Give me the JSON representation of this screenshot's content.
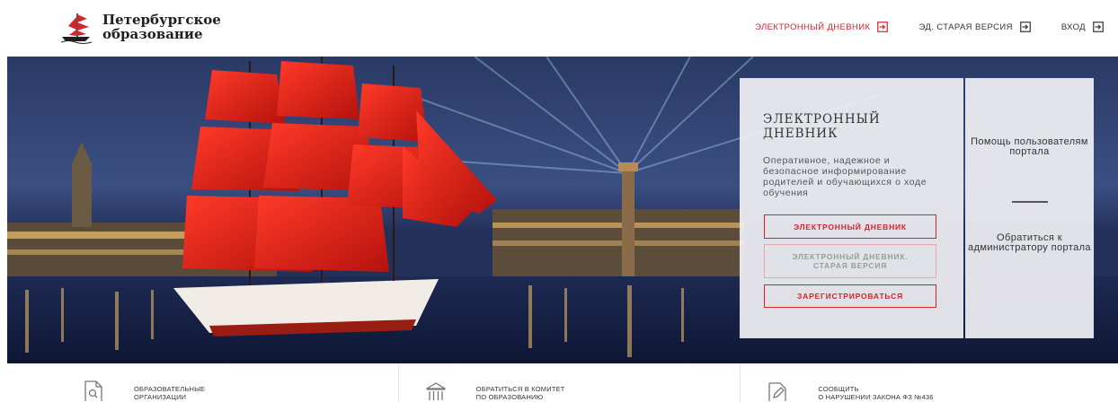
{
  "brand": {
    "line1": "Петербургское",
    "line2": "образование",
    "logo_icon": "scarlet-sails-ship-icon"
  },
  "nav": [
    {
      "label": "ЭЛЕКТРОННЫЙ ДНЕВНИК",
      "icon": "login-icon",
      "active": true
    },
    {
      "label": "ЭД. СТАРАЯ ВЕРСИЯ",
      "icon": "login-icon",
      "active": false
    },
    {
      "label": "ВХОД",
      "icon": "login-icon",
      "active": false
    }
  ],
  "hero": {
    "panel": {
      "title": "ЭЛЕКТРОННЫЙ ДНЕВНИК",
      "description": "Оперативное, надежное и безопасное информирование родителей и обучающихся о ходе обучения",
      "buttons": {
        "diary": "ЭЛЕКТРОННЫЙ ДНЕВНИК",
        "old_version": "ЭЛЕКТРОННЫЙ ДНЕВНИК. СТАРАЯ ВЕРСИЯ",
        "register": "ЗАРЕГИСТРИРОВАТЬСЯ"
      }
    },
    "help": {
      "users_help": "Помощь пользователям портала",
      "contact_admin": "Обратиться к администратору портала"
    }
  },
  "bottom": [
    {
      "line1": "ОБРАЗОВАТЕЛЬНЫЕ",
      "line2": "ОРГАНИЗАЦИИ",
      "icon": "document-search-icon"
    },
    {
      "line1": "ОБРАТИТЬСЯ В КОМИТЕТ",
      "line2": "ПО ОБРАЗОВАНИЮ",
      "icon": "government-building-icon"
    },
    {
      "line1": "СООБЩИТЬ",
      "line2": "О НАРУШЕНИИ ЗАКОНА ФЗ №436",
      "icon": "pencil-report-icon"
    }
  ],
  "colors": {
    "accent": "#d8232a",
    "panel_bg": "#f0f0f3",
    "night_sky": "#1f2d55",
    "sails": "#e8241c"
  }
}
